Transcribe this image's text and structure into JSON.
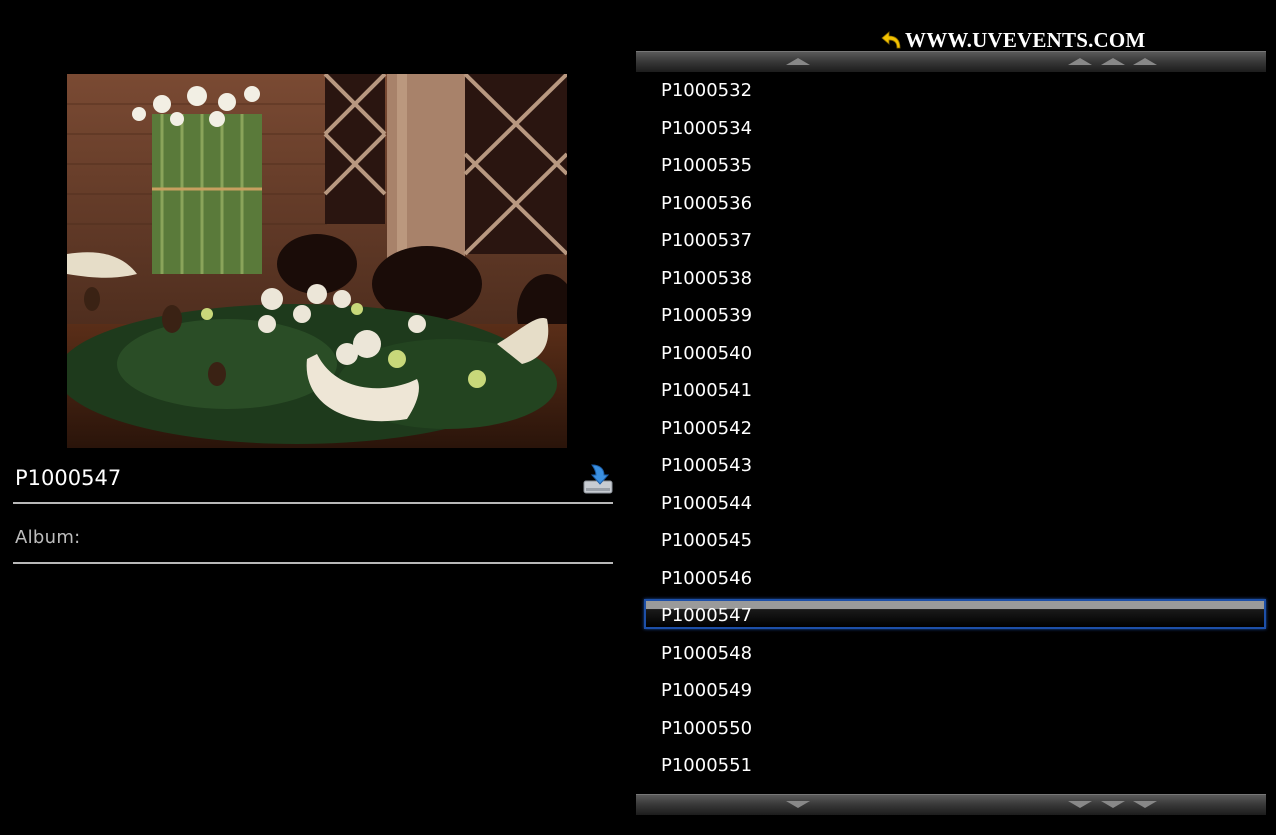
{
  "header": {
    "site_link": "WWW.UVEVENTS.COM",
    "site_link_icon": "back-arrow-icon"
  },
  "viewer": {
    "photo_alt": "P1000547",
    "photo_title": "P1000547",
    "download_icon": "download-icon",
    "album_label": "Album:",
    "album_value": ""
  },
  "file_list": {
    "scroll_up_icon": "scroll-up-icon",
    "page_up_icon": "page-up-icon",
    "scroll_down_icon": "scroll-down-icon",
    "page_down_icon": "page-down-icon",
    "selected": "P1000547",
    "items": [
      "P1000532",
      "P1000534",
      "P1000535",
      "P1000536",
      "P1000537",
      "P1000538",
      "P1000539",
      "P1000540",
      "P1000541",
      "P1000542",
      "P1000543",
      "P1000544",
      "P1000545",
      "P1000546",
      "P1000547",
      "P1000548",
      "P1000549",
      "P1000550",
      "P1000551"
    ]
  },
  "colors": {
    "background": "#000000",
    "text": "#ffffff",
    "selection_border": "#1d4fa8",
    "site_link_arrow": "#f2c200"
  }
}
